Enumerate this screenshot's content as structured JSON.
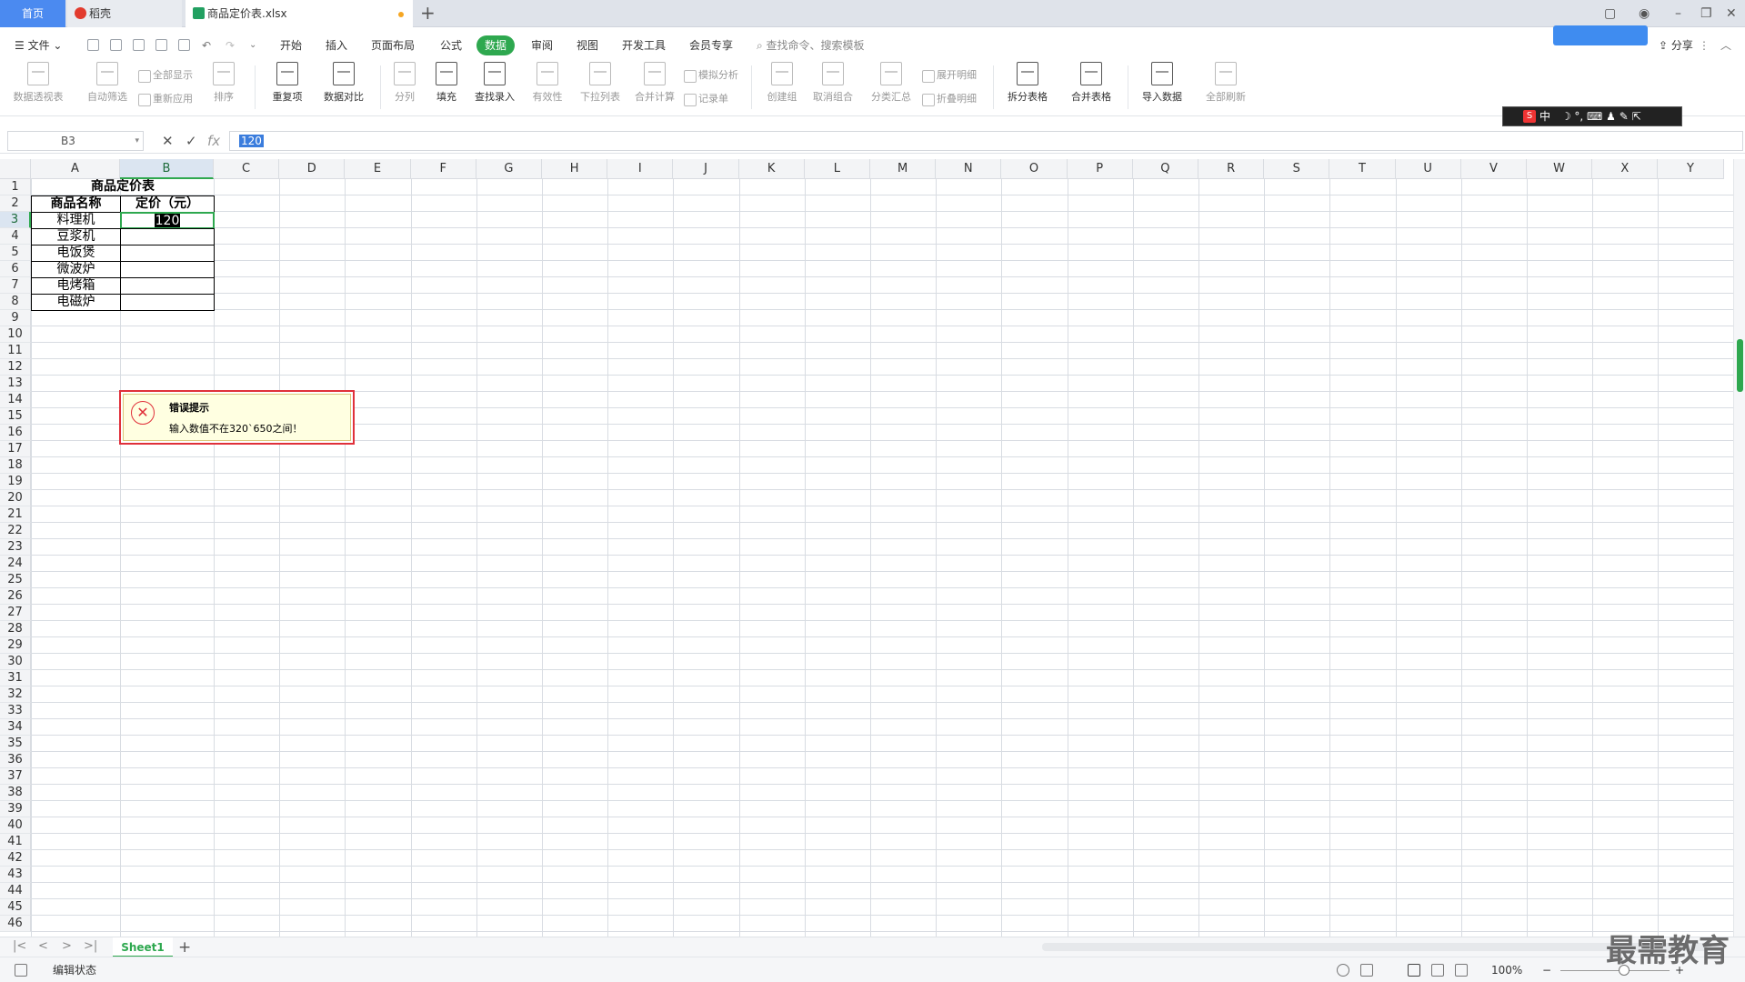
{
  "tabs": [
    {
      "label": "首页"
    },
    {
      "label": "稻壳"
    },
    {
      "label": "商品定价表.xlsx"
    }
  ],
  "menu": {
    "file": "文件",
    "items": [
      "开始",
      "插入",
      "页面布局",
      "公式",
      "数据",
      "审阅",
      "视图",
      "开发工具",
      "会员专享"
    ],
    "active": "数据",
    "search_placeholder": "查找命令、搜索模板",
    "share": "分享"
  },
  "ribbon": {
    "buttons": [
      "数据透视表",
      "自动筛选",
      "排序",
      "重复项",
      "数据对比",
      "分列",
      "填充",
      "查找录入",
      "有效性",
      "下拉列表",
      "合并计算",
      "创建组",
      "取消组合",
      "分类汇总",
      "拆分表格",
      "合并表格",
      "导入数据",
      "全部刷新"
    ],
    "small": [
      "全部显示",
      "重新应用",
      "模拟分析",
      "记录单",
      "展开明细",
      "折叠明细"
    ]
  },
  "ime": {
    "label": "中"
  },
  "formula_bar": {
    "name_box": "B3",
    "value": "120"
  },
  "grid": {
    "columns": [
      "A",
      "B",
      "C",
      "D",
      "E",
      "F",
      "G",
      "H",
      "I",
      "J",
      "K",
      "L",
      "M",
      "N",
      "O",
      "P",
      "Q",
      "R",
      "S",
      "T",
      "U",
      "V",
      "W",
      "X",
      "Y"
    ],
    "row_count": 46,
    "title": "商品定价表",
    "header": [
      "商品名称",
      "定价（元）"
    ],
    "products": [
      "料理机",
      "豆浆机",
      "电饭煲",
      "微波炉",
      "电烤箱",
      "电磁炉"
    ],
    "active_value": "120",
    "active_cell": "B3"
  },
  "error": {
    "title": "错误提示",
    "message": "输入数值不在320`650之间！"
  },
  "sheet": {
    "name": "Sheet1"
  },
  "status": {
    "mode": "编辑状态",
    "zoom": "100%"
  },
  "watermark": "最需教育",
  "colors": {
    "accent": "#2ea84f",
    "error": "#e0303a",
    "tab_home": "#4b8af0"
  }
}
